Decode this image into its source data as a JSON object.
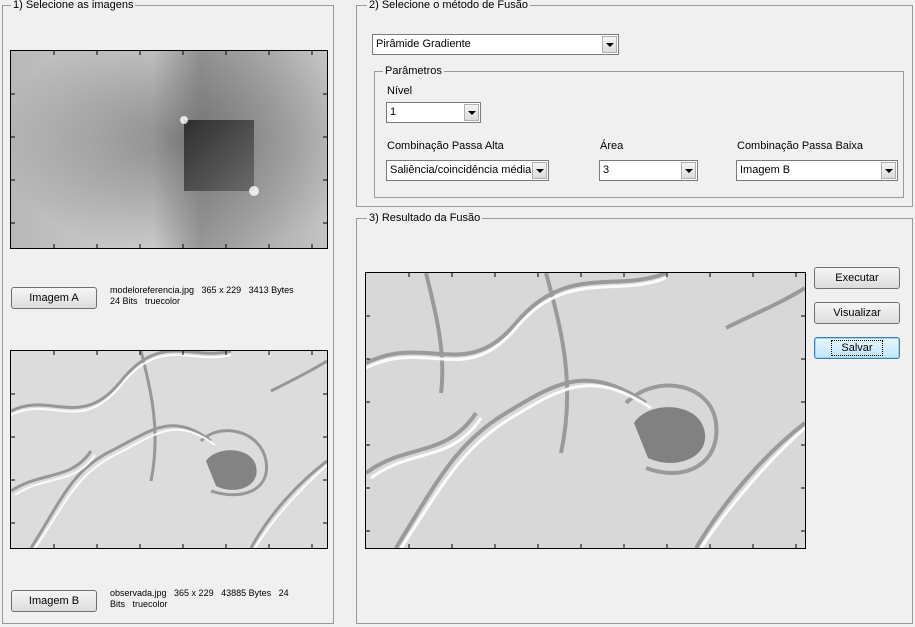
{
  "panel1": {
    "title": "1) Selecione as imagens",
    "button_a": "Imagem A",
    "info_a_line1": "modeloreferencia.jpg   365 x 229   3413 Bytes",
    "info_a_line2": "24 Bits   truecolor",
    "button_b": "Imagem B",
    "info_b_line1": "observada.jpg   365 x 229   43885 Bytes   24",
    "info_b_line2": "Bits   truecolor"
  },
  "panel2": {
    "title": "2) Selecione o método de Fusão",
    "method_value": "Pirâmide Gradiente",
    "params_title": "Parâmetros",
    "nivel_label": "Nível",
    "nivel_value": "1",
    "high_label": "Combinação Passa Alta",
    "high_value": "Saliência/coincidência média",
    "area_label": "Área",
    "area_value": "3",
    "low_label": "Combinação Passa Baixa",
    "low_value": "Imagem B"
  },
  "panel3": {
    "title": "3) Resultado da Fusão",
    "execute": "Executar",
    "view": "Visualizar",
    "save": "Salvar"
  }
}
